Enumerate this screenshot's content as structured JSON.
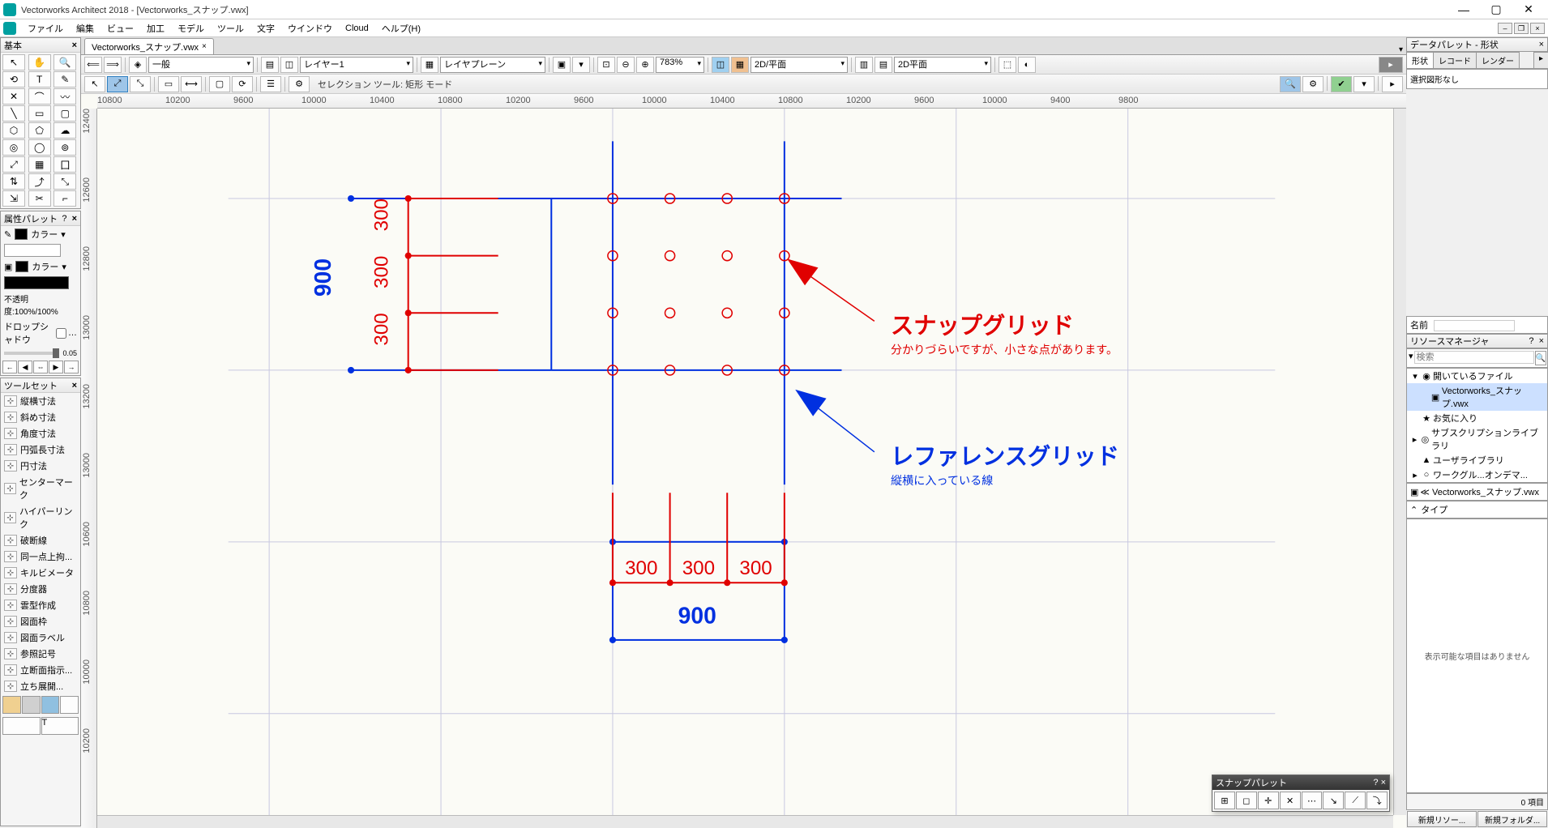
{
  "titlebar": {
    "title": "Vectorworks Architect 2018 - [Vectorworks_スナップ.vwx]"
  },
  "menubar": {
    "items": [
      "ファイル",
      "編集",
      "ビュー",
      "加工",
      "モデル",
      "ツール",
      "文字",
      "ウインドウ",
      "Cloud",
      "ヘルプ(H)"
    ]
  },
  "palettes": {
    "basic_title": "基本",
    "attr_title": "属性パレット",
    "color_label1": "カラー",
    "color_label2": "カラー",
    "opacity": "不透明度:100%/100%",
    "dropshadow": "ドロップシャドウ",
    "slider_val": "0.05",
    "toolset_title": "ツールセット",
    "toolset_items": [
      "縦横寸法",
      "斜め寸法",
      "角度寸法",
      "円弧長寸法",
      "円寸法",
      "センターマーク",
      "ハイパーリンク",
      "破断線",
      "同一点上拘...",
      "キルビメータ",
      "分度器",
      "雲型作成",
      "図面枠",
      "図面ラベル",
      "参照記号",
      "立断面指示...",
      "立ち展開..."
    ]
  },
  "doc_tab": {
    "name": "Vectorworks_スナップ.vwx"
  },
  "view_toolbar": {
    "class_sel": "一般",
    "layer_sel": "レイヤー1",
    "plane_sel": "レイヤプレーン",
    "zoom": "783%",
    "view_sel": "2D/平面",
    "render_sel": "2D平面"
  },
  "mode_toolbar": {
    "label": "セレクション ツール: 矩形 モード"
  },
  "canvas": {
    "ruler_h": [
      "10800",
      "",
      "10200",
      "",
      "9600",
      "",
      "10000",
      "",
      "10400",
      "",
      "10800",
      "",
      "10200",
      "",
      "9600",
      "",
      "10000",
      "",
      "10400",
      "",
      "10800",
      "",
      "10200",
      "",
      "9600",
      "",
      "10000",
      "",
      "9400",
      "",
      "9800"
    ],
    "ruler_v": [
      "12400",
      "12600",
      "12800",
      "13000",
      "13200",
      "13000",
      "10600",
      "10800",
      "10000",
      "10200"
    ],
    "dims_v": [
      "300",
      "300",
      "300"
    ],
    "dim_v_total": "900",
    "dims_h": [
      "300",
      "300",
      "300"
    ],
    "dim_h_total": "900",
    "anno1_title": "スナップグリッド",
    "anno1_sub": "分かりづらいですが、小さな点があります。",
    "anno2_title": "レファレンスグリッド",
    "anno2_sub": "縦横に入っている線"
  },
  "snap_palette": {
    "title": "スナップパレット"
  },
  "data_palette": {
    "title": "データパレット - 形状",
    "tabs": [
      "形状",
      "レコード",
      "レンダー"
    ],
    "body": "選択図形なし",
    "name_label": "名前"
  },
  "resource": {
    "title": "リソースマネージャ",
    "search_placeholder": "検索",
    "tree": [
      {
        "indent": 0,
        "exp": "▾",
        "icon": "◉",
        "label": "開いているファイル",
        "sel": false
      },
      {
        "indent": 1,
        "exp": "",
        "icon": "▣",
        "label": "Vectorworks_スナップ.vwx",
        "sel": true
      },
      {
        "indent": 0,
        "exp": "",
        "icon": "★",
        "label": "お気に入り",
        "sel": false
      },
      {
        "indent": 0,
        "exp": "▸",
        "icon": "◎",
        "label": "サブスクリプションライブラリ",
        "sel": false
      },
      {
        "indent": 0,
        "exp": "",
        "icon": "▲",
        "label": "ユーザライブラリ",
        "sel": false
      },
      {
        "indent": 0,
        "exp": "▸",
        "icon": "○",
        "label": "ワークグル...オンデマ...",
        "sel": false
      }
    ],
    "breadcrumb": "≪  Vectorworks_スナップ.vwx",
    "type_label": "タイプ",
    "empty": "表示可能な項目はありません",
    "status": "0 項目",
    "btn1": "新規リソー...",
    "btn2": "新規フォルダ..."
  }
}
